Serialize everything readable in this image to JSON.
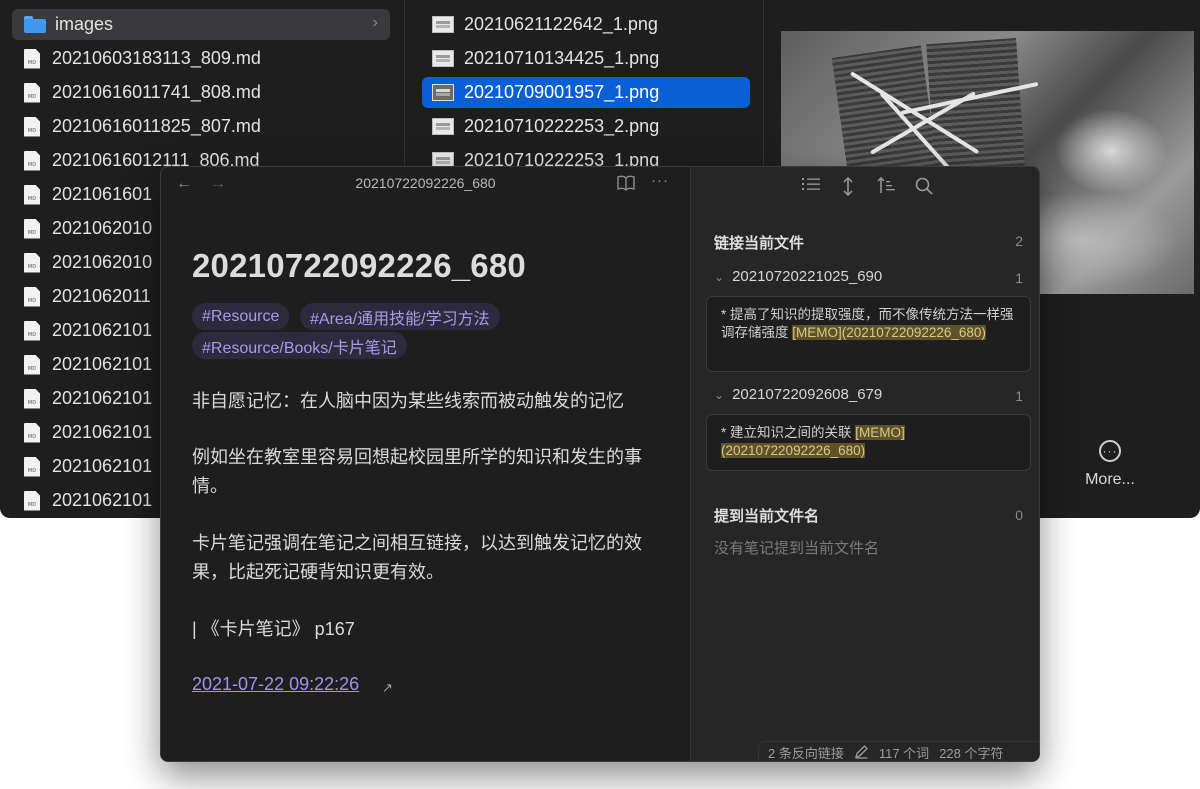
{
  "finder": {
    "col1_items": [
      {
        "name": "images",
        "kind": "folder"
      },
      {
        "name": "20210603183113_809.md",
        "kind": "md"
      },
      {
        "name": "20210616011741_808.md",
        "kind": "md"
      },
      {
        "name": "20210616011825_807.md",
        "kind": "md"
      },
      {
        "name": "20210616012111_806.md",
        "kind": "md"
      },
      {
        "name": "2021061601",
        "kind": "md"
      },
      {
        "name": "2021062010",
        "kind": "md"
      },
      {
        "name": "2021062010",
        "kind": "md"
      },
      {
        "name": "2021062011",
        "kind": "md"
      },
      {
        "name": "2021062101",
        "kind": "md"
      },
      {
        "name": "2021062101",
        "kind": "md"
      },
      {
        "name": "2021062101",
        "kind": "md"
      },
      {
        "name": "2021062101",
        "kind": "md"
      },
      {
        "name": "2021062101",
        "kind": "md"
      },
      {
        "name": "2021062101",
        "kind": "md"
      }
    ],
    "md_badge": "MD",
    "folder_chevron": "›",
    "col2_items": [
      {
        "name": "20210621122642_1.png"
      },
      {
        "name": "20210710134425_1.png"
      },
      {
        "name": "20210709001957_1.png",
        "selected": true
      },
      {
        "name": "20210710222253_2.png"
      },
      {
        "name": "20210710222253_1.png"
      }
    ],
    "more_label": "More...",
    "more_glyph": "···"
  },
  "editor": {
    "nav_back": "←",
    "nav_forward": "→",
    "view_title": "20210722092226_680",
    "read_icon": "book-open-icon",
    "more_icon": "···",
    "title": "20210722092226_680",
    "tags": [
      "#Resource",
      "#Area/通用技能/学习方法",
      "#Resource/Books/卡片笔记"
    ],
    "paragraphs": [
      "非自愿记忆：在人脑中因为某些线索而被动触发的记忆",
      "例如坐在教室里容易回想起校园里所学的知识和发生的事情。",
      "卡片笔记强调在笔记之间相互链接，以达到触发记忆的效果，比起死记硬背知识更有效。",
      "| 《卡片笔记》 p167"
    ],
    "date_link": "2021-07-22 09:22:26",
    "ext_icon": "↗"
  },
  "backlinks": {
    "toolbar_icons": [
      "list-icon",
      "expand-vertical-icon",
      "sort-icon",
      "search-icon"
    ],
    "linked_heading": "链接当前文件",
    "linked_count": "2",
    "files": [
      {
        "name": "20210720221025_690",
        "count": "1",
        "snippet_before": "* 提高了知识的提取强度，而不像传统方法一样强调存储强度 ",
        "snippet_highlight": "[MEMO](20210722092226_680)"
      },
      {
        "name": "20210722092608_679",
        "count": "1",
        "snippet_before": "* 建立知识之间的关联 ",
        "snippet_highlight": "[MEMO](20210722092226_680)"
      }
    ],
    "unlinked_heading": "提到当前文件名",
    "unlinked_count": "0",
    "unlinked_empty": "没有笔记提到当前文件名",
    "caret": "⌄"
  },
  "status": {
    "backlinks": "2 条反向链接",
    "words": "117 个词",
    "chars": "228 个字符"
  }
}
